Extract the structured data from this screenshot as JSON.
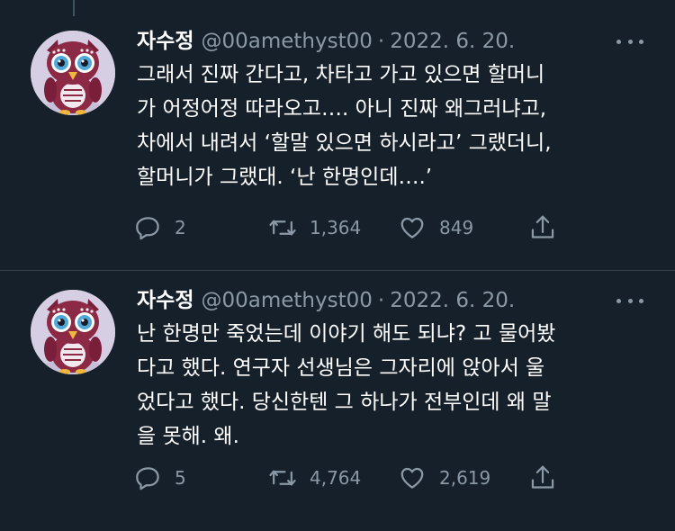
{
  "tweets": [
    {
      "name": "자수정",
      "handle": "@00amethyst00",
      "separator": "·",
      "date": "2022. 6. 20.",
      "lines": [
        "그래서 진짜 간다고, 차타고 가고 있으면 할머니",
        "가 어정어정 따라오고…. 아니 진짜 왜그러냐고,",
        "차에서 내려서 ‘할말 있으면 하시라고’ 그랬더니,",
        "할머니가 그랬대. ‘난 한명인데….’"
      ],
      "replies": "2",
      "retweets": "1,364",
      "likes": "849"
    },
    {
      "name": "자수정",
      "handle": "@00amethyst00",
      "separator": "·",
      "date": "2022. 6. 20.",
      "lines": [
        "난 한명만 죽었는데 이야기 해도 되냐? 고 물어봤",
        "다고 했다. 연구자 선생님은 그자리에 앉아서 울",
        "었다고 했다. 당신한텐 그 하나가 전부인데 왜 말",
        "을 못해. 왜."
      ],
      "replies": "5",
      "retweets": "4,764",
      "likes": "2,619"
    }
  ]
}
